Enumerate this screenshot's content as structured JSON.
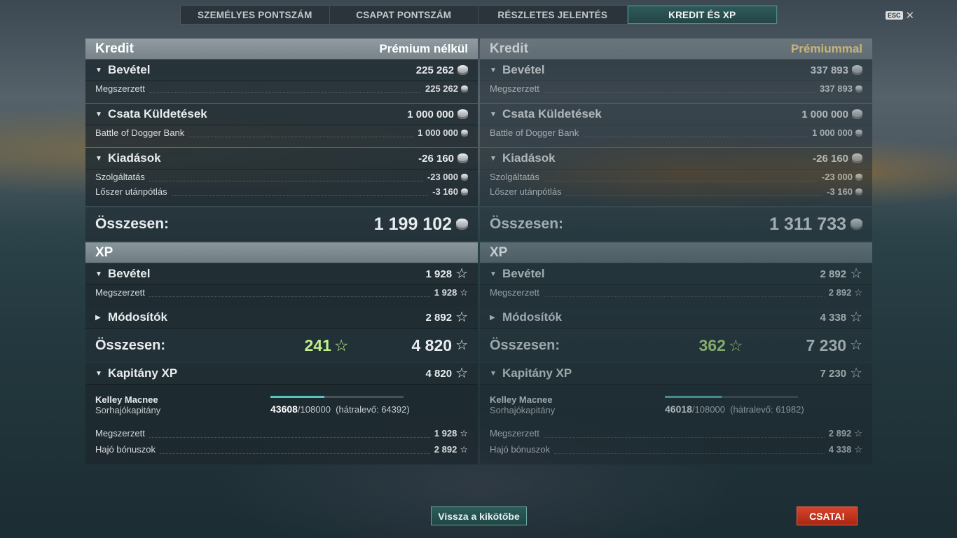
{
  "tabs": [
    "SZEMÉLYES PONTSZÁM",
    "CSAPAT PONTSZÁM",
    "RÉSZLETES JELENTÉS",
    "KREDIT ÉS XP"
  ],
  "esc_label": "ESC",
  "columns": {
    "left": {
      "credit": {
        "title": "Kredit",
        "tag": "Prémium nélkül",
        "income": {
          "label": "Bevétel",
          "value": "225 262",
          "items": [
            {
              "label": "Megszerzett",
              "value": "225 262"
            }
          ]
        },
        "missions": {
          "label": "Csata Küldetések",
          "value": "1 000 000",
          "items": [
            {
              "label": "Battle of Dogger Bank",
              "value": "1 000 000"
            }
          ]
        },
        "expenses": {
          "label": "Kiadások",
          "value": "-26 160",
          "items": [
            {
              "label": "Szolgáltatás",
              "value": "-23 000"
            },
            {
              "label": "Lőszer utánpótlás",
              "value": "-3 160"
            }
          ]
        },
        "total": {
          "label": "Összesen:",
          "value": "1 199 102"
        }
      },
      "xp": {
        "title": "XP",
        "income": {
          "label": "Bevétel",
          "value": "1 928",
          "items": [
            {
              "label": "Megszerzett",
              "value": "1 928"
            }
          ]
        },
        "modifiers": {
          "label": "Módosítók",
          "value": "2 892"
        },
        "total": {
          "label": "Összesen:",
          "bonus": "241",
          "value": "4 820"
        },
        "captain": {
          "label": "Kapitány XP",
          "value": "4 820",
          "name": "Kelley Macnee",
          "role": "Sorhajókapitány",
          "progress": 0.404,
          "current": "43608",
          "max": "/108000",
          "remaining": "(hátralevő: 64392)",
          "items": [
            {
              "label": "Megszerzett",
              "value": "1 928"
            },
            {
              "label": "Hajó bónuszok",
              "value": "2 892"
            }
          ]
        }
      }
    },
    "right": {
      "credit": {
        "title": "Kredit",
        "tag": "Prémiummal",
        "income": {
          "label": "Bevétel",
          "value": "337 893",
          "items": [
            {
              "label": "Megszerzett",
              "value": "337 893"
            }
          ]
        },
        "missions": {
          "label": "Csata Küldetések",
          "value": "1 000 000",
          "items": [
            {
              "label": "Battle of Dogger Bank",
              "value": "1 000 000"
            }
          ]
        },
        "expenses": {
          "label": "Kiadások",
          "value": "-26 160",
          "items": [
            {
              "label": "Szolgáltatás",
              "value": "-23 000"
            },
            {
              "label": "Lőszer utánpótlás",
              "value": "-3 160"
            }
          ]
        },
        "total": {
          "label": "Összesen:",
          "value": "1 311 733"
        }
      },
      "xp": {
        "title": "XP",
        "income": {
          "label": "Bevétel",
          "value": "2 892",
          "items": [
            {
              "label": "Megszerzett",
              "value": "2 892"
            }
          ]
        },
        "modifiers": {
          "label": "Módosítók",
          "value": "4 338"
        },
        "total": {
          "label": "Összesen:",
          "bonus": "362",
          "value": "7 230"
        },
        "captain": {
          "label": "Kapitány XP",
          "value": "7 230",
          "name": "Kelley Macnee",
          "role": "Sorhajókapitány",
          "progress": 0.426,
          "current": "46018",
          "max": "/108000",
          "remaining": "(hátralevő: 61982)",
          "items": [
            {
              "label": "Megszerzett",
              "value": "2 892"
            },
            {
              "label": "Hajó bónuszok",
              "value": "4 338"
            }
          ]
        }
      }
    }
  },
  "buttons": {
    "back_to_port": "Vissza a kikötőbe",
    "battle": "CSATA!"
  },
  "colors": {
    "accent": "#58c3c0",
    "battle": "#c93a22",
    "bonus": "#bff08a",
    "premium": "#c9b478"
  }
}
